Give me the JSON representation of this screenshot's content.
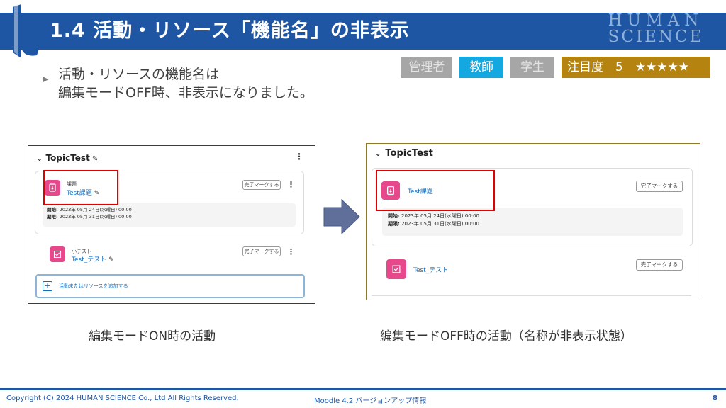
{
  "header": {
    "title": "1.4 活動・リソース「機能名」の非表示",
    "brand_line1": "HUMAN",
    "brand_line2": "SCIENCE"
  },
  "badges": {
    "admin": "管理者",
    "teacher": "教師",
    "student": "学生",
    "attention": "注目度　5　★★★★★"
  },
  "bullet": {
    "line1": "活動・リソースの機能名は",
    "line2": "編集モードOFF時、非表示になりました。"
  },
  "left_screen": {
    "section_title": "TopicTest",
    "assign": {
      "type_label": "課題",
      "name": "Test課題",
      "done_button": "完了マークする",
      "opened_label": "開始:",
      "opened_value": "2023年 05月 24日(水曜日) 00:00",
      "due_label": "期限:",
      "due_value": "2023年 05月 31日(水曜日) 00:00"
    },
    "quiz": {
      "type_label": "小テスト",
      "name": "Test_テスト",
      "done_button": "完了マークする"
    },
    "add_activity": "活動またはリソースを追加する"
  },
  "right_screen": {
    "section_title": "TopicTest",
    "assign": {
      "name": "Test課題",
      "done_button": "完了マークする",
      "opened_label": "開始:",
      "opened_value": "2023年 05月 24日(水曜日) 00:00",
      "due_label": "期限:",
      "due_value": "2023年 05月 31日(水曜日) 00:00"
    },
    "quiz": {
      "name": "Test_テスト",
      "done_button": "完了マークする"
    }
  },
  "captions": {
    "left": "編集モードON時の活動",
    "right": "編集モードOFF時の活動（名称が非表示状態）"
  },
  "footer": {
    "copyright": "Copyright (C) 2024 HUMAN SCIENCE Co., Ltd All Rights Reserved.",
    "center": "Moodle 4.2 バージョンアップ情報",
    "page": "8"
  },
  "colors": {
    "header_bg": "#1f56a3",
    "teacher_badge": "#13a8e0",
    "inactive_badge": "#a6a6a6",
    "attention_badge": "#b58410",
    "activity_icon": "#e7478b",
    "highlight": "#e00000"
  }
}
